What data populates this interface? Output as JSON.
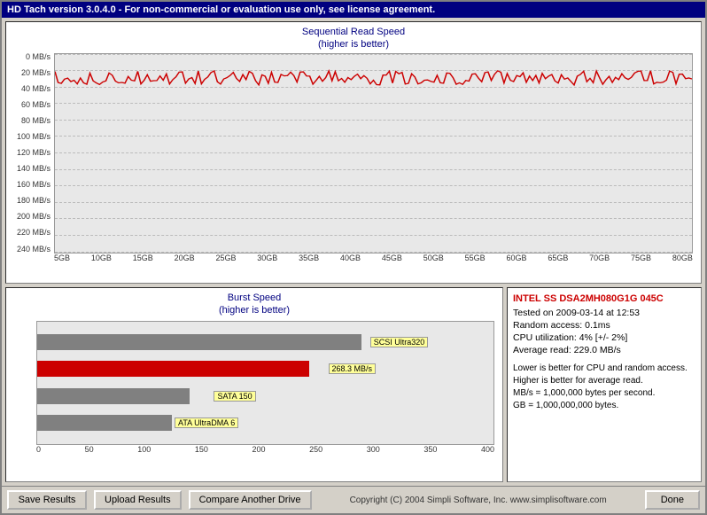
{
  "window": {
    "title": "HD Tach version 3.0.4.0  - For non-commercial or evaluation use only, see license agreement."
  },
  "seq_chart": {
    "title_line1": "Sequential Read Speed",
    "title_line2": "(higher is better)",
    "y_labels": [
      "0 MB/s",
      "20 MB/s",
      "40 MB/s",
      "60 MB/s",
      "80 MB/s",
      "100 MB/s",
      "120 MB/s",
      "140 MB/s",
      "160 MB/s",
      "180 MB/s",
      "200 MB/s",
      "220 MB/s",
      "240 MB/s"
    ],
    "x_labels": [
      "5GB",
      "10GB",
      "15GB",
      "20GB",
      "25GB",
      "30GB",
      "35GB",
      "40GB",
      "45GB",
      "50GB",
      "55GB",
      "60GB",
      "65GB",
      "70GB",
      "75GB",
      "80GB"
    ]
  },
  "burst_chart": {
    "title_line1": "Burst Speed",
    "title_line2": "(higher is better)",
    "bars": [
      {
        "label": "SCSI Ultra320",
        "value": 320,
        "max": 450,
        "color": "#808080"
      },
      {
        "label": "268.3 MB/s",
        "value": 268.3,
        "max": 450,
        "color": "#cc0000"
      },
      {
        "label": "SATA 150",
        "value": 150,
        "max": 450,
        "color": "#808080"
      },
      {
        "label": "ATA UltraDMA 6",
        "value": 133,
        "max": 450,
        "color": "#808080"
      }
    ],
    "x_labels": [
      "0",
      "50",
      "100",
      "150",
      "200",
      "250",
      "300",
      "350",
      "400"
    ]
  },
  "info": {
    "title": "INTEL SS DSA2MH080G1G  045C",
    "lines": [
      "Tested on 2009-03-14 at 12:53",
      "Random access: 0.1ms",
      "CPU utilization: 4% [+/- 2%]",
      "Average read: 229.0 MB/s"
    ],
    "notes": [
      "Lower is better for CPU and random access.",
      "Higher is better for average read.",
      "MB/s = 1,000,000 bytes per second.",
      "GB = 1,000,000,000 bytes."
    ]
  },
  "toolbar": {
    "save_label": "Save Results",
    "upload_label": "Upload Results",
    "compare_label": "Compare Another Drive",
    "copyright": "Copyright (C) 2004 Simpli Software, Inc. www.simplisoftware.com",
    "done_label": "Done"
  }
}
